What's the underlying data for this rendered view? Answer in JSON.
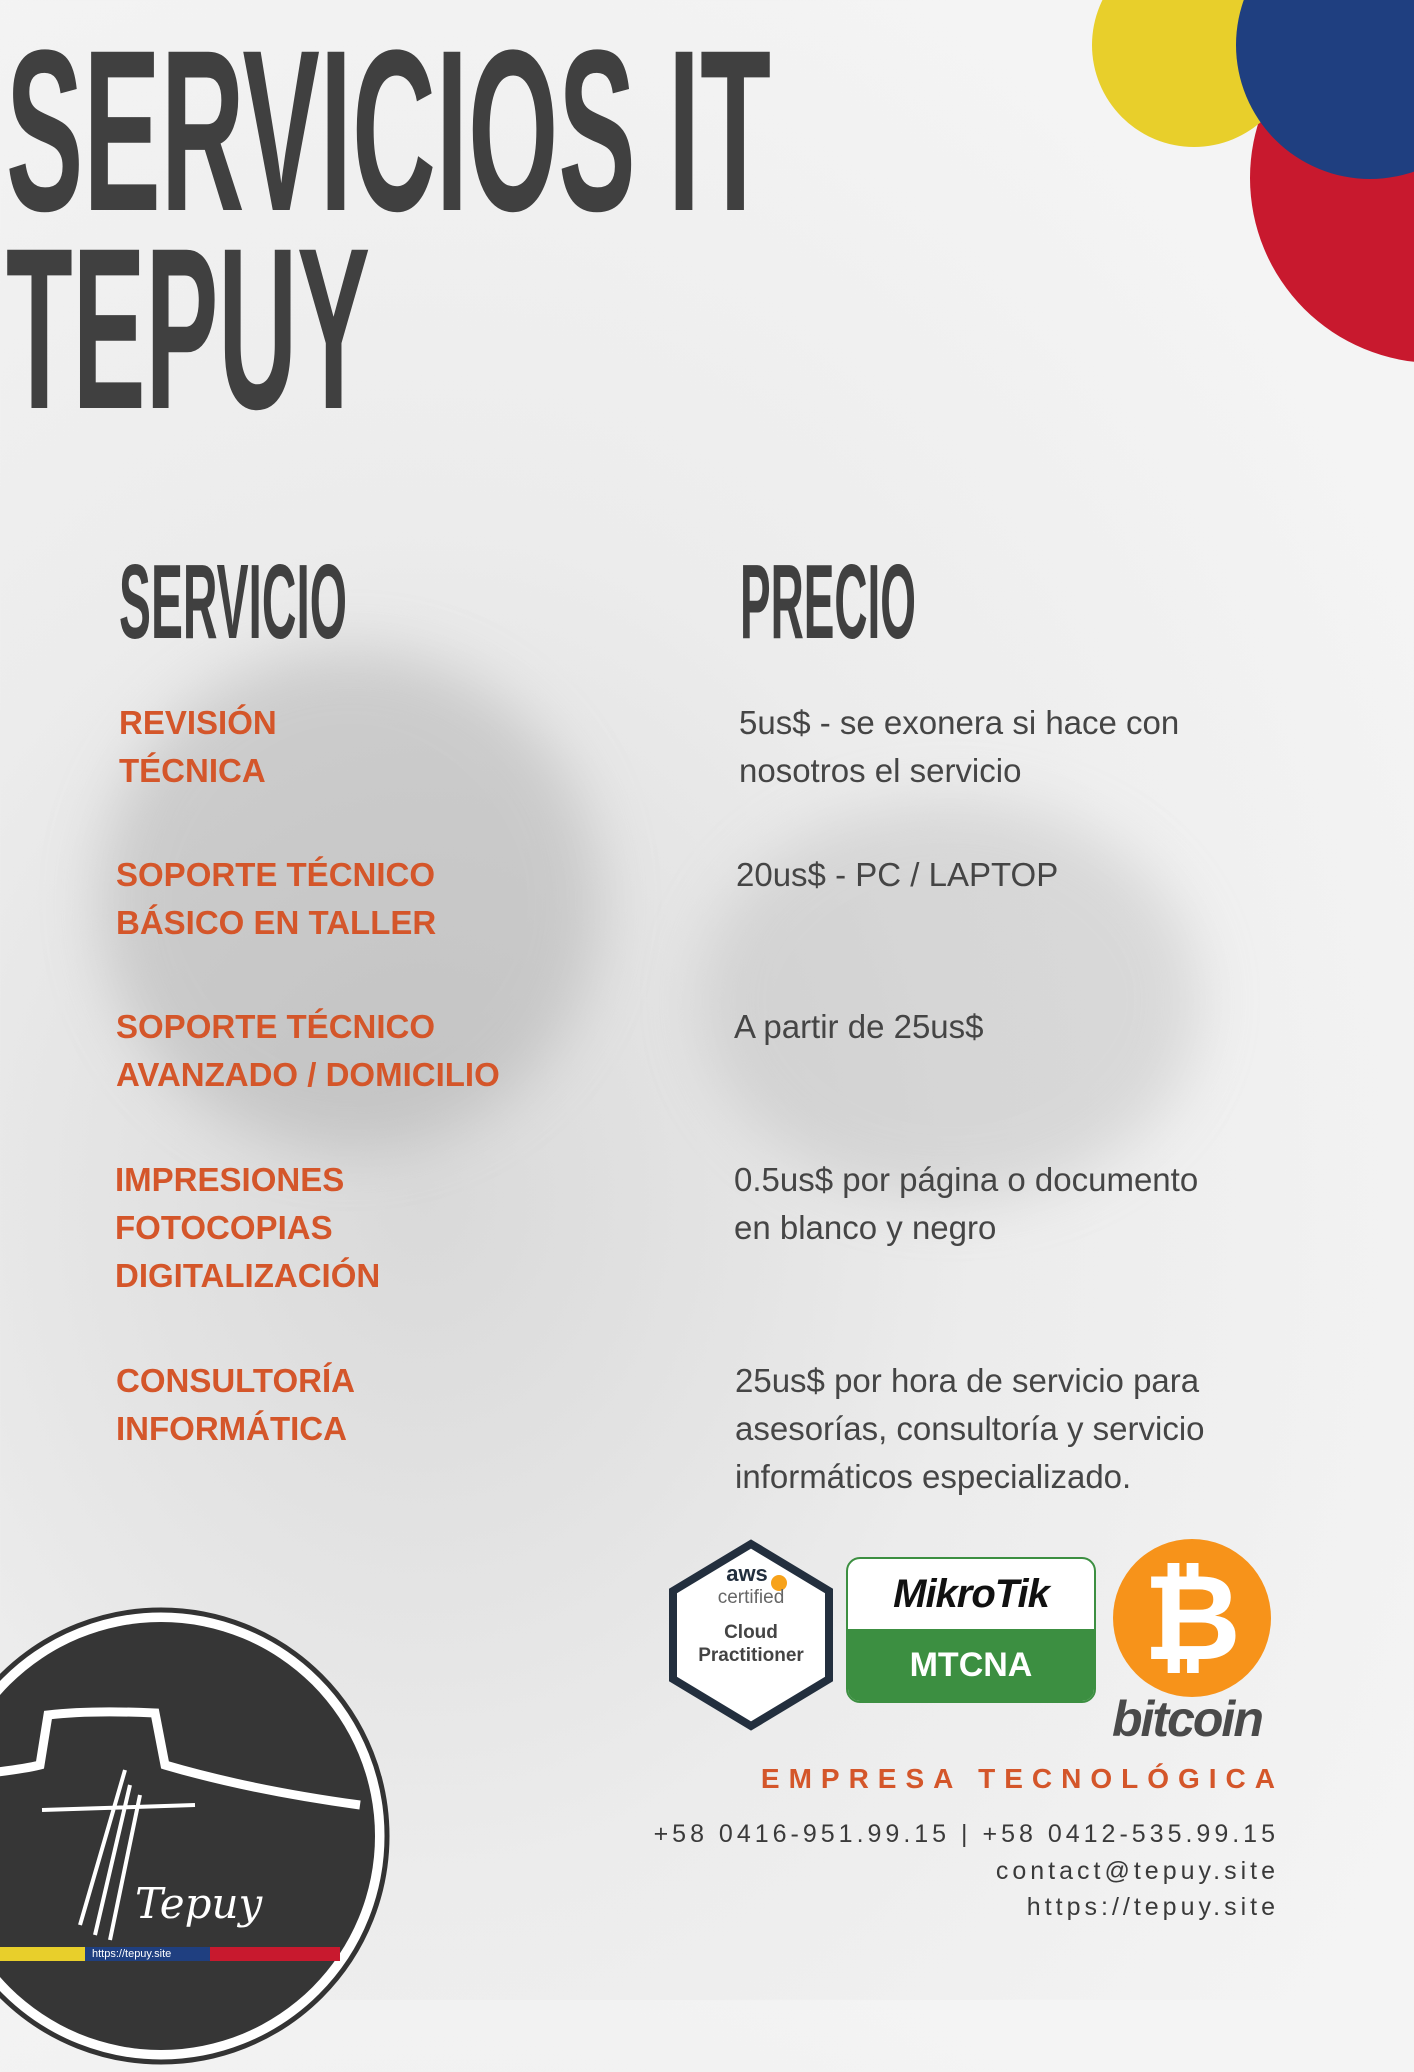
{
  "title": {
    "line1": "SERVICIOS IT",
    "line2": "TEPUY"
  },
  "headers": {
    "service": "SERVICIO",
    "price": "PRECIO"
  },
  "rows": [
    {
      "service": "REVISIÓN\nTÉCNICA",
      "price": "5us$ - se exonera si hace con\nnosotros el servicio"
    },
    {
      "service": "SOPORTE TÉCNICO\nBÁSICO EN TALLER",
      "price": "20us$ - PC / LAPTOP"
    },
    {
      "service": "SOPORTE TÉCNICO\nAVANZADO / DOMICILIO",
      "price": "A partir de 25us$"
    },
    {
      "service": "IMPRESIONES\nFOTOCOPIAS\nDIGITALIZACIÓN",
      "price": "0.5us$ por página o documento\nen blanco y negro"
    },
    {
      "service": "CONSULTORÍA\nINFORMÁTICA",
      "price": "25us$ por hora de servicio para\nasesorías, consultoría y servicio\ninformáticos especializado."
    }
  ],
  "badges": {
    "aws": {
      "brand": "aws",
      "line1": "certified",
      "line2": "Cloud",
      "line3": "Practitioner"
    },
    "mikrotik": {
      "brand": "MikroTik",
      "cert": "MTCNA"
    },
    "bitcoin": {
      "symbol": "₿",
      "label": "bitcoin"
    }
  },
  "footer": {
    "tagline": "EMPRESA TECNOLÓGICA",
    "phones": "+58 0416-951.99.15 | +58 0412-535.99.15",
    "email": "contact@tepuy.site",
    "website": "https://tepuy.site"
  },
  "logo": {
    "script": "Tepuy",
    "url": "https://tepuy.site"
  },
  "colors": {
    "accent": "#d4562a",
    "yellow": "#e8cf2b",
    "blue": "#1f3f80",
    "red": "#c8192e",
    "green": "#3c8f41",
    "bitcoin": "#f7931a"
  }
}
